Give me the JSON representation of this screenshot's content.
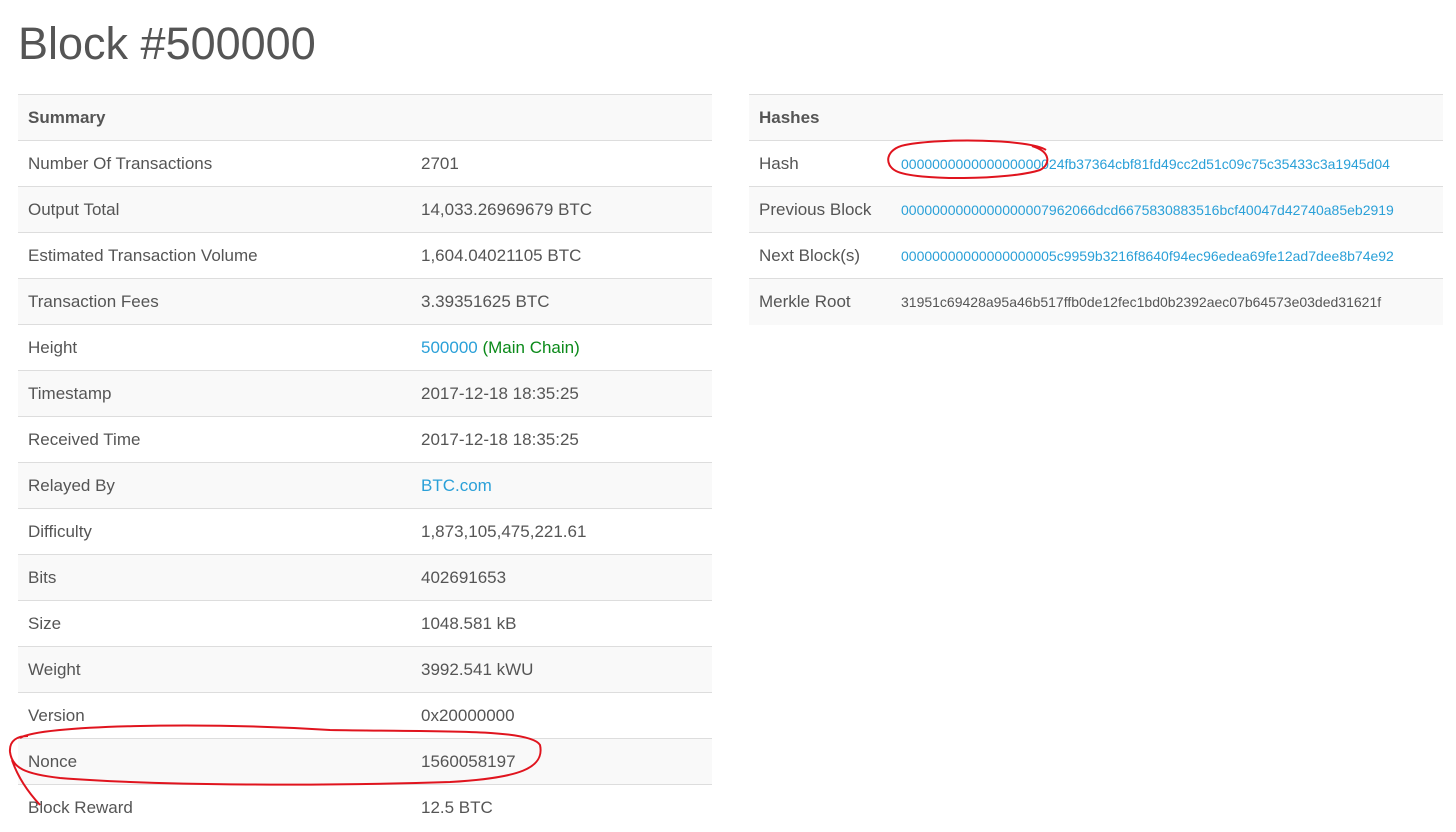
{
  "page": {
    "title": "Block #500000"
  },
  "summary": {
    "heading": "Summary",
    "rows": [
      {
        "label": "Number Of Transactions",
        "value": "2701"
      },
      {
        "label": "Output Total",
        "value": "14,033.26969679 BTC"
      },
      {
        "label": "Estimated Transaction Volume",
        "value": "1,604.04021105 BTC"
      },
      {
        "label": "Transaction Fees",
        "value": "3.39351625 BTC"
      },
      {
        "label": "Height",
        "value_link": "500000",
        "value_suffix": "(Main Chain)"
      },
      {
        "label": "Timestamp",
        "value": "2017-12-18 18:35:25"
      },
      {
        "label": "Received Time",
        "value": "2017-12-18 18:35:25"
      },
      {
        "label": "Relayed By",
        "value_link": "BTC.com"
      },
      {
        "label": "Difficulty",
        "value": "1,873,105,475,221.61"
      },
      {
        "label": "Bits",
        "value": "402691653"
      },
      {
        "label": "Size",
        "value": "1048.581 kB"
      },
      {
        "label": "Weight",
        "value": "3992.541 kWU"
      },
      {
        "label": "Version",
        "value": "0x20000000"
      },
      {
        "label": "Nonce",
        "value": "1560058197"
      },
      {
        "label": "Block Reward",
        "value": "12.5 BTC"
      }
    ]
  },
  "hashes": {
    "heading": "Hashes",
    "rows": [
      {
        "label": "Hash",
        "value": "000000000000000000024fb37364cbf81fd49cc2d51c09c75c35433c3a1945d04"
      },
      {
        "label": "Previous Block",
        "value": "0000000000000000007962066dcd6675830883516bcf40047d42740a85eb2919"
      },
      {
        "label": "Next Block(s)",
        "value": "00000000000000000005c9959b3216f8640f94ec96edea69fe12ad7dee8b74e92"
      },
      {
        "label": "Merkle Root",
        "value": "31951c69428a95a46b517ffb0de12fec1bd0b2392aec07b64573e03ded31621f"
      }
    ]
  },
  "colors": {
    "link": "#2aa0d8",
    "main_chain": "#0b8a1a",
    "annotation": "#e0141e",
    "stripe": "#f9f9f9",
    "border": "#dddddd"
  }
}
